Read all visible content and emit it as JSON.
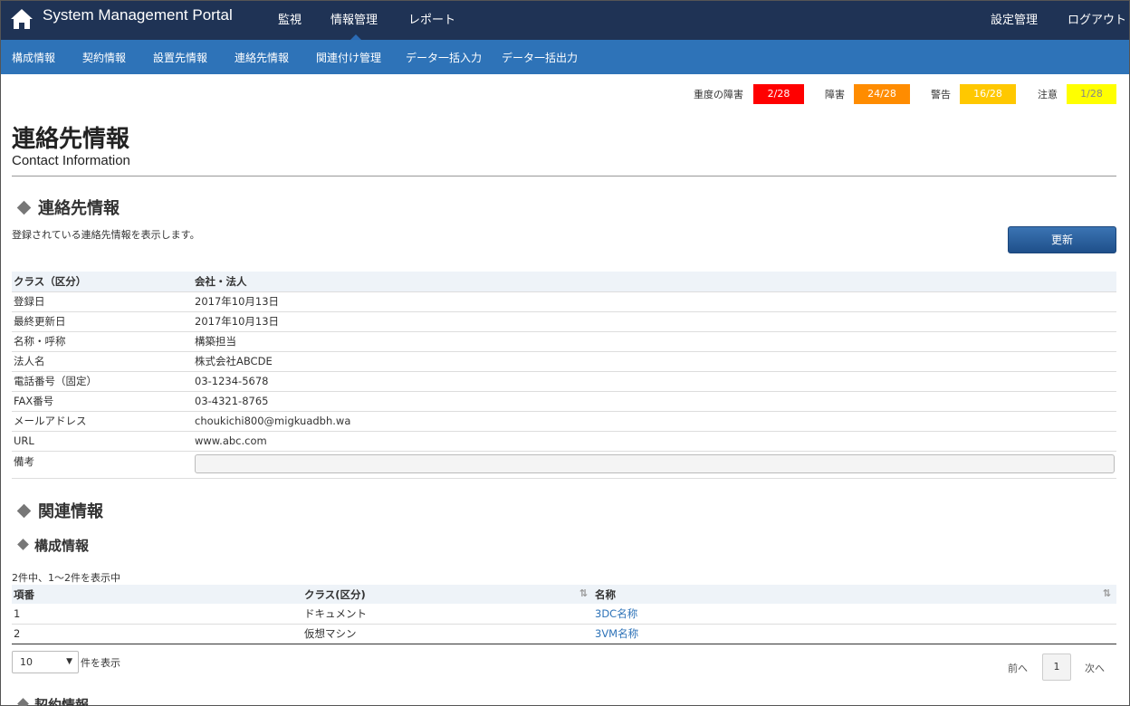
{
  "header": {
    "brand": "System Management Portal",
    "nav": [
      "監視",
      "情報管理",
      "レポート"
    ],
    "right": [
      "設定管理",
      "ログアウト"
    ]
  },
  "subnav": [
    "構成情報",
    "契約情報",
    "設置先情報",
    "連絡先情報",
    "関連付け管理",
    "データ一括入力",
    "データ一括出力"
  ],
  "alerts": [
    {
      "label": "重度の障害",
      "value": "2/28",
      "color": "#ff0000",
      "text_color": "#ffffff"
    },
    {
      "label": "障害",
      "value": "24/28",
      "color": "#ff8c00",
      "text_color": "#ffffff"
    },
    {
      "label": "警告",
      "value": "16/28",
      "color": "#ffc800",
      "text_color": "#ffffff"
    },
    {
      "label": "注意",
      "value": "1/28",
      "color": "#ffff00",
      "text_color": "#888888"
    }
  ],
  "page": {
    "title": "連絡先情報",
    "subtitle": "Contact Information"
  },
  "contact": {
    "heading": "連絡先情報",
    "description": "登録されている連絡先情報を表示します。",
    "refresh_label": "更新",
    "rows": [
      {
        "key": "クラス（区分）",
        "value": "会社・法人"
      },
      {
        "key": "登録日",
        "value": "2017年10月13日"
      },
      {
        "key": "最終更新日",
        "value": "2017年10月13日"
      },
      {
        "key": "名称・呼称",
        "value": "構築担当"
      },
      {
        "key": "法人名",
        "value": "株式会社ABCDE"
      },
      {
        "key": "電話番号（固定）",
        "value": "03-1234-5678"
      },
      {
        "key": "FAX番号",
        "value": "03-4321-8765"
      },
      {
        "key": "メールアドレス",
        "value": "choukichi800@migkuadbh.wa"
      },
      {
        "key": "URL",
        "value": "www.abc.com"
      }
    ],
    "memo_key": "備考",
    "memo_value": ""
  },
  "related": {
    "heading": "関連情報",
    "config": {
      "heading": "構成情報",
      "count_text": "2件中、1〜2件を表示中",
      "columns": [
        "項番",
        "クラス(区分)",
        "名称"
      ],
      "rows": [
        {
          "no": "1",
          "class": "ドキュメント",
          "name": "3DC名称"
        },
        {
          "no": "2",
          "class": "仮想マシン",
          "name": "3VM名称"
        }
      ],
      "page_size": "10",
      "page_size_label": "件を表示",
      "prev_label": "前へ",
      "current_page": "1",
      "next_label": "次へ"
    },
    "contract_heading": "契約情報"
  }
}
